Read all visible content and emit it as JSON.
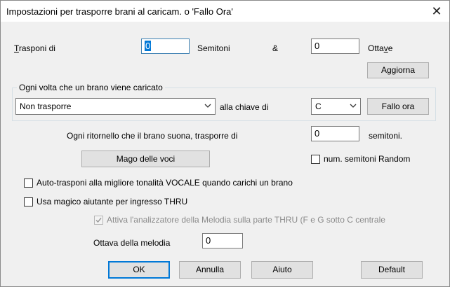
{
  "dialog": {
    "title": "Impostazioni per trasporre brani al caricam. o 'Fallo Ora'",
    "close_symbol": "✕"
  },
  "transpose_row": {
    "label_first": "T",
    "label_rest": "rasponi di",
    "semitones_value": "0",
    "semitones_label": "Semitoni",
    "ampersand": "&",
    "octaves_value": "0",
    "octaves_label_a": "Otta",
    "octaves_label_u": "v",
    "octaves_label_b": "e",
    "update_button": "Aggiorna"
  },
  "group": {
    "label": "Ogni volta che un brano viene caricato",
    "mode_value": "Non trasporre",
    "key_label": "alla chiave di",
    "key_value": "C",
    "do_now_button": "Fallo ora"
  },
  "chorus": {
    "label": "Ogni ritornello che il brano suona, trasporre di",
    "value": "0",
    "unit": "semitoni."
  },
  "voice_wizard_button": "Mago delle voci",
  "random_checkbox": {
    "label": "num. semitoni Random",
    "checked": false
  },
  "auto_transpose": {
    "label": "Auto-trasponi alla migliore tonalità VOCALE quando carichi un brano",
    "checked": false
  },
  "magic_helper": {
    "label": "Usa magico aiutante per ingresso THRU",
    "checked": false
  },
  "melody_analyzer": {
    "label": "Attiva l'analizzatore della Melodia sulla parte THRU (F e G sotto C centrale",
    "checked": true,
    "enabled": false
  },
  "melody_octave": {
    "label": "Ottava della melodia",
    "value": "0"
  },
  "buttons": {
    "ok": "OK",
    "cancel": "Annulla",
    "help": "Aiuto",
    "default": "Default"
  },
  "colors": {
    "accent": "#0078d7",
    "window_bg": "#f0f0f0"
  }
}
